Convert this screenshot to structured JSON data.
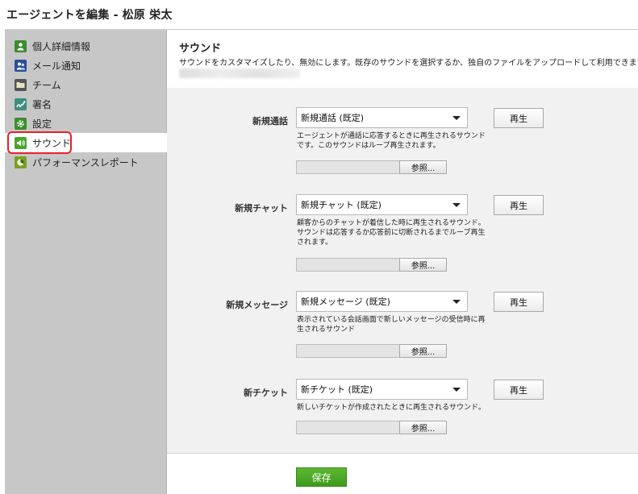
{
  "page": {
    "title": "エージェントを編集 - 松原 栄太"
  },
  "sidebar": {
    "items": [
      {
        "label": "個人詳細情報",
        "icon": "person-icon",
        "color": "#3c8c2e"
      },
      {
        "label": "メール通知",
        "icon": "users-icon",
        "color": "#2b4f9a"
      },
      {
        "label": "チーム",
        "icon": "folder-icon",
        "color": "#555555"
      },
      {
        "label": "署名",
        "icon": "signature-icon",
        "color": "#3f8e7e"
      },
      {
        "label": "設定",
        "icon": "gear-icon",
        "color": "#3b8f2f"
      },
      {
        "label": "サウンド",
        "icon": "speaker-icon",
        "color": "#4aa52c"
      },
      {
        "label": "パフォーマンスレポート",
        "icon": "chart-icon",
        "color": "#7aa021"
      }
    ],
    "active_index": 5,
    "highlight_color": "#e8202a"
  },
  "main": {
    "title": "サウンド",
    "description": "サウンドをカスタマイズしたり、無効にします。既存のサウンドを選択するか、独自のファイルをアップロードして利用できます。",
    "rows": [
      {
        "label": "新規通話",
        "selected": "新規通話 (既定)",
        "play": "再生",
        "help": "エージェントが通話に応答するときに再生されるサウンドです。このサウンドはループ再生されます。",
        "browse": "参照..."
      },
      {
        "label": "新規チャット",
        "selected": "新規チャット (既定)",
        "play": "再生",
        "help": "顧客からのチャットが着信した時に再生されるサウンド。サウンドは応答するか応答前に切断されるまでループ再生されます。",
        "browse": "参照..."
      },
      {
        "label": "新規メッセージ",
        "selected": "新規メッセージ (既定)",
        "play": "再生",
        "help": "表示されている会話画面で新しいメッセージの受信時に再生されるサウンド",
        "browse": "参照..."
      },
      {
        "label": "新チケット",
        "selected": "新チケット (既定)",
        "play": "再生",
        "help": "新しいチケットが作成されたときに再生されるサウンド。",
        "browse": "参照..."
      }
    ],
    "save": "保存",
    "save_color": "#4caa28"
  }
}
